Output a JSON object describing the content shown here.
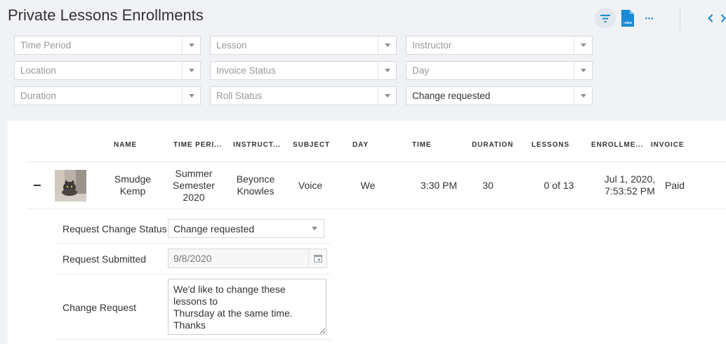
{
  "page": {
    "title": "Private Lessons Enrollments"
  },
  "toolbar": {
    "filter_icon": "filter-icon",
    "xlsx_icon": "xlsx-file-icon",
    "xlsx_label": ".xlsx",
    "more_label": "•••",
    "accent_color": "#1a8ad6"
  },
  "filters": [
    {
      "placeholder": "Time Period",
      "value": ""
    },
    {
      "placeholder": "Lesson",
      "value": ""
    },
    {
      "placeholder": "Instructor",
      "value": ""
    },
    {
      "placeholder": "Location",
      "value": ""
    },
    {
      "placeholder": "Invoice Status",
      "value": ""
    },
    {
      "placeholder": "Day",
      "value": ""
    },
    {
      "placeholder": "Duration",
      "value": ""
    },
    {
      "placeholder": "Roll Status",
      "value": ""
    },
    {
      "placeholder": "Roll Status",
      "value": "Change requested"
    }
  ],
  "filter_labels": [
    "Time Period",
    "Lesson",
    "Instructor",
    "Location",
    "Invoice Status",
    "Day",
    "Duration",
    "Roll Status",
    "Change requested"
  ],
  "table": {
    "columns": [
      "NAME",
      "TIME PERI...",
      "INSTRUCT...",
      "SUBJECT",
      "DAY",
      "TIME",
      "DURATION",
      "LESSONS",
      "ENROLLME...",
      "INVOICE"
    ],
    "row": {
      "name_line1": "Smudge",
      "name_line2": "Kemp",
      "time_period_line1": "Summer",
      "time_period_line2": "Semester",
      "time_period_line3": "2020",
      "instructor_line1": "Beyonce",
      "instructor_line2": "Knowles",
      "subject": "Voice",
      "day": "We",
      "time": "3:30 PM",
      "duration": "30",
      "lessons": "0 of 13",
      "enrollment_line1": "Jul 1, 2020,",
      "enrollment_line2": "7:53:52 PM",
      "invoice": "Paid"
    }
  },
  "detail": {
    "status_label": "Request Change Status",
    "status_value": "Change requested",
    "submitted_label": "Request Submitted",
    "submitted_value": "9/8/2020",
    "request_label": "Change Request",
    "request_text": "We'd like to change these lessons to\nThursday at the same time.\nThanks"
  }
}
